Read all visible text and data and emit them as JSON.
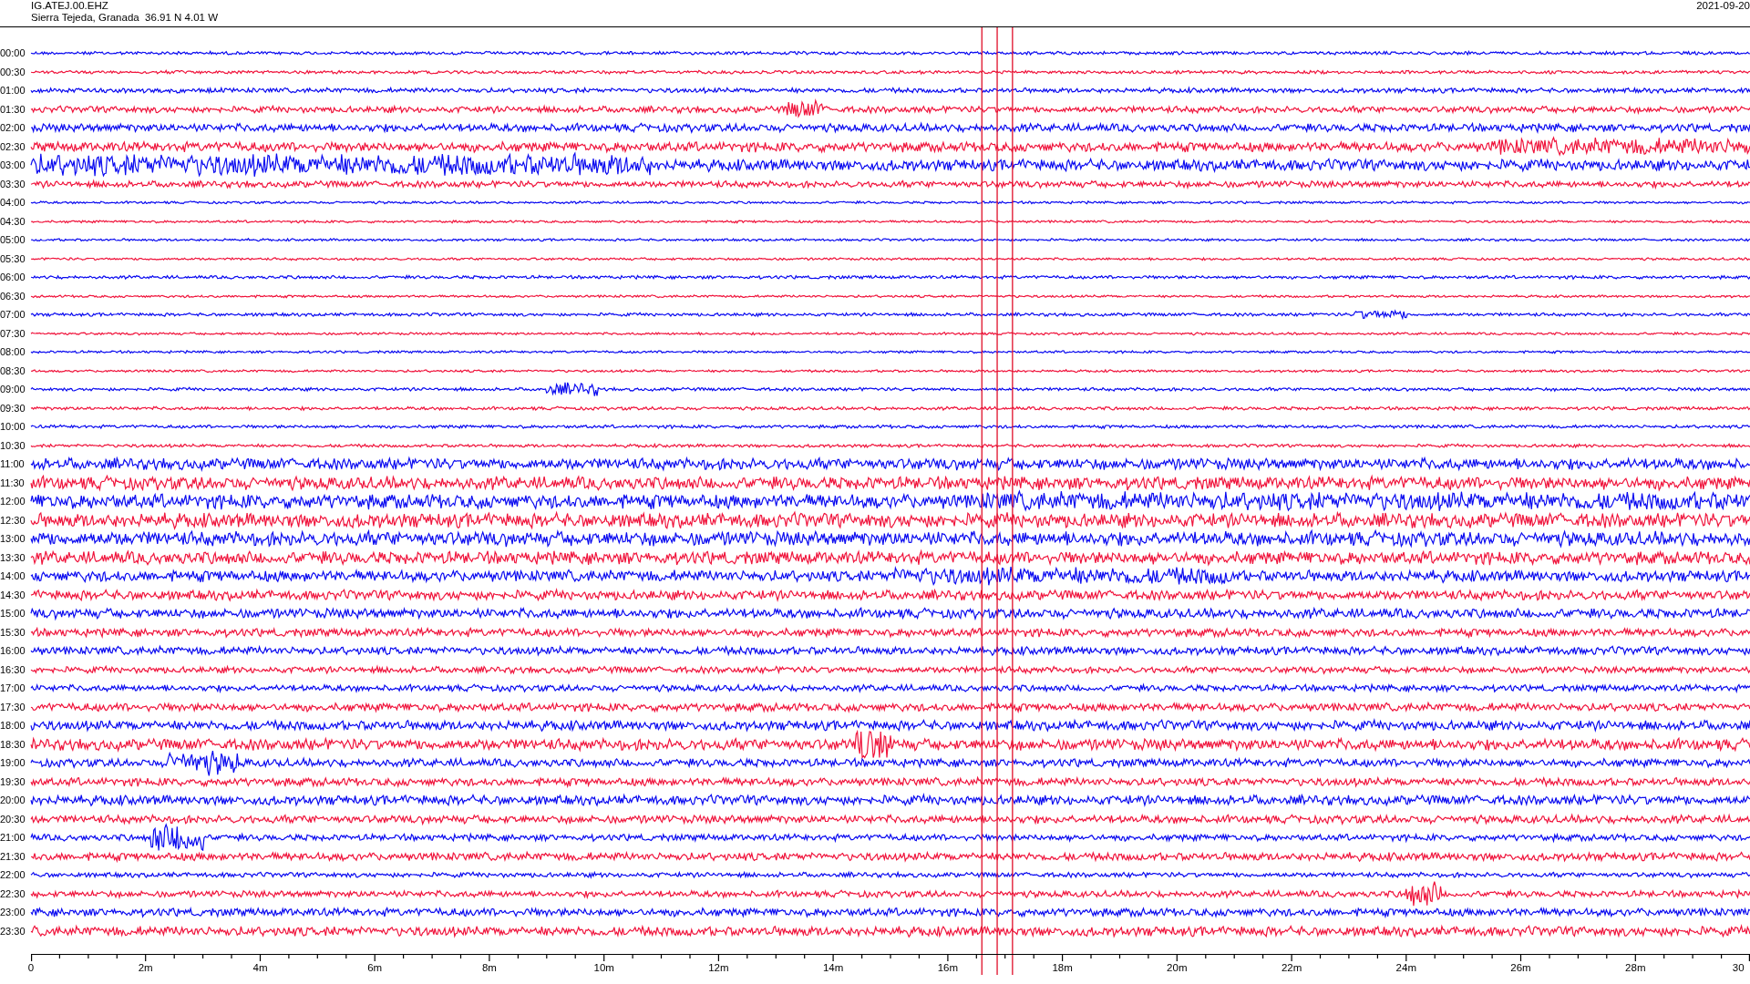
{
  "header": {
    "station": "IG.ATEJ.00.EHZ",
    "location": "Sierra Tejeda, Granada  36.91 N 4.01 W",
    "date": "2021-09-20"
  },
  "traces": [
    {
      "label": "00:00",
      "color": "#0a0af0"
    },
    {
      "label": "00:30",
      "color": "#f0143c"
    },
    {
      "label": "01:00",
      "color": "#0a0af0"
    },
    {
      "label": "01:30",
      "color": "#f0143c"
    },
    {
      "label": "02:00",
      "color": "#0a0af0"
    },
    {
      "label": "02:30",
      "color": "#f0143c"
    },
    {
      "label": "03:00",
      "color": "#0a0af0"
    },
    {
      "label": "03:30",
      "color": "#f0143c"
    },
    {
      "label": "04:00",
      "color": "#0a0af0"
    },
    {
      "label": "04:30",
      "color": "#f0143c"
    },
    {
      "label": "05:00",
      "color": "#0a0af0"
    },
    {
      "label": "05:30",
      "color": "#f0143c"
    },
    {
      "label": "06:00",
      "color": "#0a0af0"
    },
    {
      "label": "06:30",
      "color": "#f0143c"
    },
    {
      "label": "07:00",
      "color": "#0a0af0"
    },
    {
      "label": "07:30",
      "color": "#f0143c"
    },
    {
      "label": "08:00",
      "color": "#0a0af0"
    },
    {
      "label": "08:30",
      "color": "#f0143c"
    },
    {
      "label": "09:00",
      "color": "#0a0af0"
    },
    {
      "label": "09:30",
      "color": "#f0143c"
    },
    {
      "label": "10:00",
      "color": "#0a0af0"
    },
    {
      "label": "10:30",
      "color": "#f0143c"
    },
    {
      "label": "11:00",
      "color": "#0a0af0"
    },
    {
      "label": "11:30",
      "color": "#f0143c"
    },
    {
      "label": "12:00",
      "color": "#0a0af0"
    },
    {
      "label": "12:30",
      "color": "#f0143c"
    },
    {
      "label": "13:00",
      "color": "#0a0af0"
    },
    {
      "label": "13:30",
      "color": "#f0143c"
    },
    {
      "label": "14:00",
      "color": "#0a0af0"
    },
    {
      "label": "14:30",
      "color": "#f0143c"
    },
    {
      "label": "15:00",
      "color": "#0a0af0"
    },
    {
      "label": "15:30",
      "color": "#f0143c"
    },
    {
      "label": "16:00",
      "color": "#0a0af0"
    },
    {
      "label": "16:30",
      "color": "#f0143c"
    },
    {
      "label": "17:00",
      "color": "#0a0af0"
    },
    {
      "label": "17:30",
      "color": "#f0143c"
    },
    {
      "label": "18:00",
      "color": "#0a0af0"
    },
    {
      "label": "18:30",
      "color": "#f0143c"
    },
    {
      "label": "19:00",
      "color": "#0a0af0"
    },
    {
      "label": "19:30",
      "color": "#f0143c"
    },
    {
      "label": "20:00",
      "color": "#0a0af0"
    },
    {
      "label": "20:30",
      "color": "#f0143c"
    },
    {
      "label": "21:00",
      "color": "#0a0af0"
    },
    {
      "label": "21:30",
      "color": "#f0143c"
    },
    {
      "label": "22:00",
      "color": "#0a0af0"
    },
    {
      "label": "22:30",
      "color": "#f0143c"
    },
    {
      "label": "23:00",
      "color": "#0a0af0"
    },
    {
      "label": "23:30",
      "color": "#f0143c"
    }
  ],
  "x_axis": {
    "ticks": [
      "0",
      "2m",
      "4m",
      "6m",
      "8m",
      "10m",
      "12m",
      "14m",
      "16m",
      "18m",
      "20m",
      "22m",
      "24m",
      "26m",
      "28m",
      "30"
    ]
  }
}
